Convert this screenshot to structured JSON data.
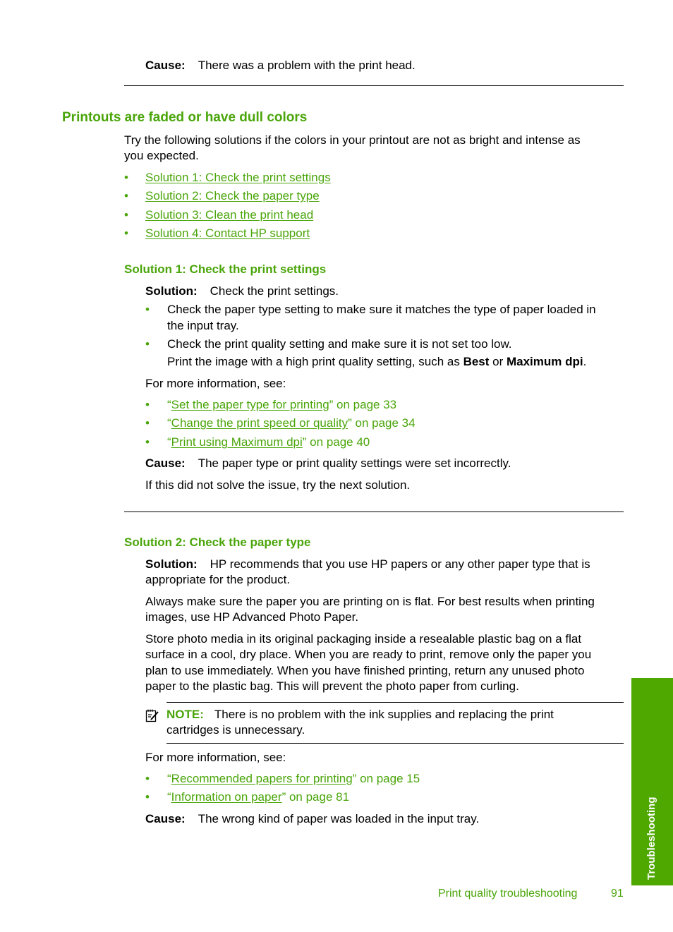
{
  "top": {
    "cause_label": "Cause:",
    "cause_text": "There was a problem with the print head."
  },
  "section": {
    "title": "Printouts are faded or have dull colors",
    "intro_line1": "Try the following solutions if the colors in your printout are not as bright and intense as",
    "intro_line2": "you expected.",
    "solution_links": [
      "Solution 1: Check the print settings",
      "Solution 2: Check the paper type",
      "Solution 3: Clean the print head",
      "Solution 4: Contact HP support"
    ]
  },
  "solution1": {
    "heading": "Solution 1: Check the print settings",
    "solution_label": "Solution:",
    "solution_text": "Check the print settings.",
    "bullets": [
      {
        "line1": "Check the paper type setting to make sure it matches the type of paper loaded in",
        "line2": "the input tray."
      },
      {
        "line1": "Check the print quality setting and make sure it is not set too low.",
        "line2_pre": "Print the image with a high print quality setting, such as ",
        "line2_b1": "Best",
        "line2_mid": " or ",
        "line2_b2": "Maximum dpi",
        "line2_post": "."
      }
    ],
    "more_info": "For more information, see:",
    "refs": [
      {
        "open": "“",
        "link": "Set the paper type for printing",
        "rest": "” on page 33"
      },
      {
        "open": "“",
        "link": "Change the print speed or quality",
        "rest": "” on page 34"
      },
      {
        "open": "“",
        "link": "Print using Maximum dpi",
        "rest": "” on page 40"
      }
    ],
    "cause_label": "Cause:",
    "cause_text": "The paper type or print quality settings were set incorrectly.",
    "next": "If this did not solve the issue, try the next solution."
  },
  "solution2": {
    "heading": "Solution 2: Check the paper type",
    "solution_label": "Solution:",
    "solution_line1": "HP recommends that you use HP papers or any other paper type that is",
    "solution_line2": "appropriate for the product.",
    "para1_line1": "Always make sure the paper you are printing on is flat. For best results when printing",
    "para1_line2": "images, use HP Advanced Photo Paper.",
    "para2_lines": [
      "Store photo media in its original packaging inside a resealable plastic bag on a flat",
      "surface in a cool, dry place. When you are ready to print, remove only the paper you",
      "plan to use immediately. When you have finished printing, return any unused photo",
      "paper to the plastic bag. This will prevent the photo paper from curling."
    ],
    "note_icon": "note-pencil-icon",
    "note_label": "NOTE:",
    "note_line1": "There is no problem with the ink supplies and replacing the print",
    "note_line2": "cartridges is unnecessary.",
    "more_info": "For more information, see:",
    "refs": [
      {
        "open": "“",
        "link": "Recommended papers for printing",
        "rest": "” on page 15"
      },
      {
        "open": "“",
        "link": "Information on paper",
        "rest": "” on page 81"
      }
    ],
    "cause_label": "Cause:",
    "cause_text": "The wrong kind of paper was loaded in the input tray."
  },
  "sidebar_tab": "Troubleshooting",
  "footer": {
    "section": "Print quality troubleshooting",
    "page": "91"
  },
  "bullet": "•"
}
